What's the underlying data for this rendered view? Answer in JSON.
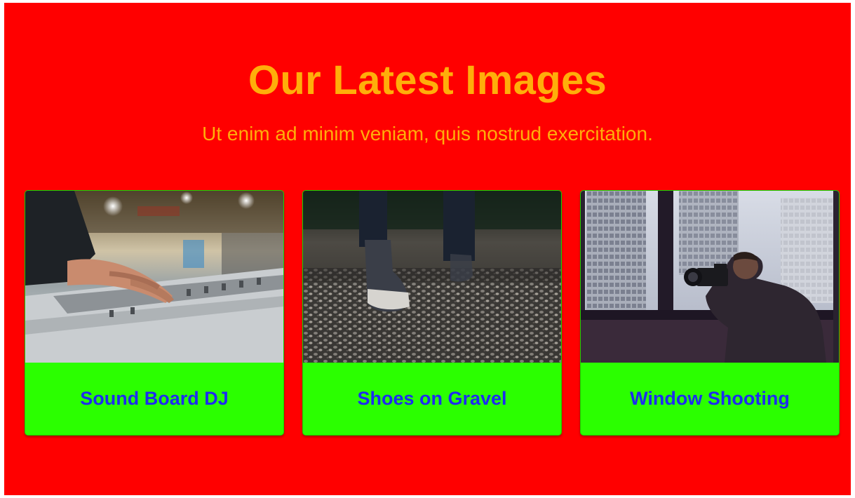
{
  "section": {
    "title": "Our Latest Images",
    "subtitle": "Ut enim ad minim veniam, quis nostrud exercitation."
  },
  "colors": {
    "background": "#ff0000",
    "heading": "#ffae0a",
    "card_bg": "#2bff00",
    "caption_text": "#1d2cf0"
  },
  "cards": [
    {
      "caption": "Sound Board DJ",
      "image": "dj-mixing-desk-photo"
    },
    {
      "caption": "Shoes on Gravel",
      "image": "sneakers-on-gravel-photo"
    },
    {
      "caption": "Window Shooting",
      "image": "photographer-at-window-photo"
    }
  ]
}
